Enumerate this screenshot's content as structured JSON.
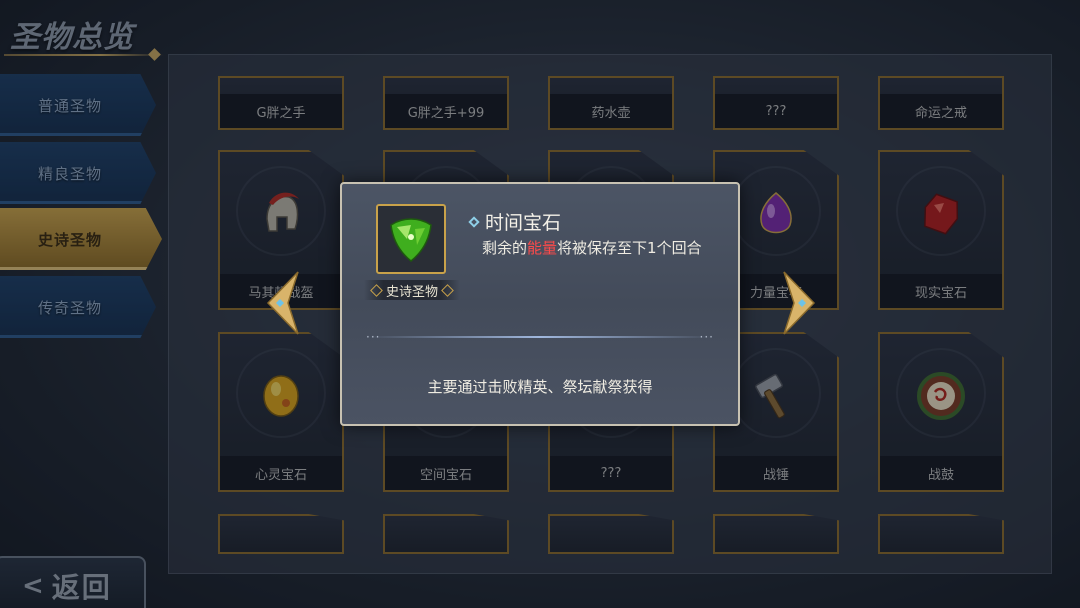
{
  "header": {
    "title": "圣物总览"
  },
  "menu": {
    "items": [
      {
        "label": "普通圣物",
        "active": false
      },
      {
        "label": "精良圣物",
        "active": false
      },
      {
        "label": "史诗圣物",
        "active": true
      },
      {
        "label": "传奇圣物",
        "active": false
      }
    ]
  },
  "back": {
    "arrow": "<",
    "label": "返回"
  },
  "grid": {
    "row1": [
      "G胖之手",
      "G胖之手+99",
      "药水壶",
      "???",
      "命运之戒"
    ],
    "row2": [
      "马其顿战盔",
      "",
      "",
      "力量宝石",
      "现实宝石"
    ],
    "row3": [
      "心灵宝石",
      "空间宝石",
      "???",
      "战锤",
      "战鼓"
    ],
    "row2_icons": [
      "helmet-icon",
      "",
      "",
      "purple-gem-icon",
      "red-gem-icon"
    ],
    "row3_icons": [
      "yellow-gem-icon",
      "",
      "",
      "hammer-icon",
      "drum-icon"
    ]
  },
  "popup": {
    "name": "时间宝石",
    "rarity": "史诗圣物",
    "desc_before": "剩余的",
    "desc_highlight": "能量",
    "desc_after": "将被保存至下1个回合",
    "dots_left": "···",
    "dots_right": "···",
    "source": "主要通过击败精英、祭坛献祭获得",
    "icon": "green-gem-icon"
  },
  "colors": {
    "accent_gold": "#c9a24a",
    "menu_blue": "#1f3f66",
    "highlight_red": "#ff4a4a"
  }
}
